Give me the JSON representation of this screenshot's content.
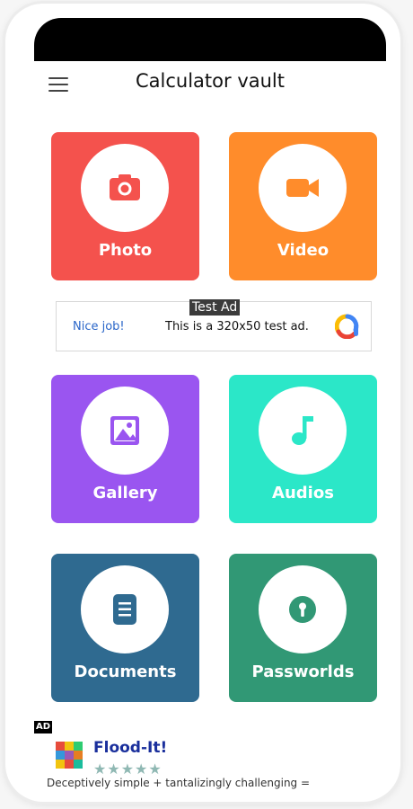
{
  "app": {
    "title": "Calculator vault"
  },
  "tiles": [
    {
      "label": "Photo",
      "color": "#f4524d",
      "icon": "camera-icon"
    },
    {
      "label": "Video",
      "color": "#ff8c2b",
      "icon": "video-camera-icon"
    },
    {
      "label": "Gallery",
      "color": "#9a55f0",
      "icon": "image-icon"
    },
    {
      "label": "Audios",
      "color": "#2be7c8",
      "icon": "music-note-icon"
    },
    {
      "label": "Documents",
      "color": "#2f6a90",
      "icon": "document-icon"
    },
    {
      "label": "Passworlds",
      "color": "#319875",
      "icon": "lock-icon"
    }
  ],
  "ad_banner": {
    "tag": "Test Ad",
    "left_text": "Nice job!",
    "body_text": "This is a 320x50 test ad.",
    "logo_icon": "ads-logo-icon"
  },
  "bottom_ad": {
    "badge": "AD",
    "title": "Flood-It!",
    "rating": "★★★★★",
    "description": "Deceptively simple + tantalizingly challenging =",
    "icon": "cube-icon"
  }
}
